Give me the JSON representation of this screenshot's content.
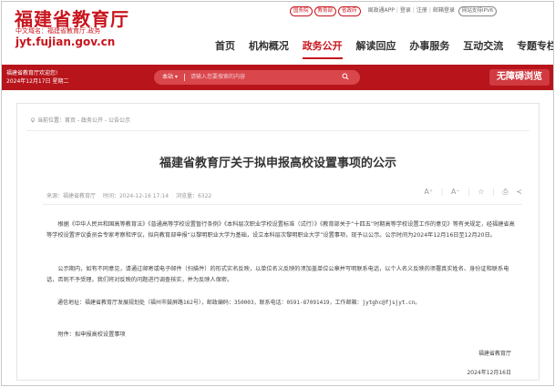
{
  "header": {
    "title": "福建省教育厅",
    "domain_cn": "中文域名：福建省教育厅.政务",
    "domain": "jyt.fujian.gov.cn",
    "badges": [
      "国务院",
      "教育部",
      "省政府"
    ],
    "links": [
      "闽政通APP",
      "登录",
      "注册",
      "邮箱登录"
    ],
    "ipv6": "网站支持IPV6"
  },
  "nav": {
    "items": [
      "首页",
      "机构概况",
      "政务公开",
      "解读回应",
      "办事服务",
      "互动交流",
      "专题专栏"
    ],
    "active_index": 2
  },
  "bar": {
    "welcome_line1": "福建省教育厅欢迎您!",
    "welcome_line2": "2024年12月17日 星期二",
    "search_scope": "本站",
    "search_placeholder": "请输入您要搜索的内容",
    "accessibility": "无障碍浏览"
  },
  "breadcrumb": {
    "label": "当前位置：",
    "path": "首页 - 政务公开 - 公告公示"
  },
  "article": {
    "title": "福建省教育厅关于拟申报高校设置事项的公示",
    "source": "来源：福建省教育厅",
    "time": "时间：2024-12-16 17:14",
    "views": "浏览量：6322",
    "tools": [
      "A⁺",
      "A⁻"
    ],
    "para1": "根据《中华人民共和国高等教育法》《普通高等学校设置暂行条例》《本科层次职业学校设置标准（试行）》《教育部关于“十四五”时期高等学校设置工作的意见》等有关规定，经福建省高等学校设置评议委员会专家考察和评议，拟向教育部申报“以黎明职业大学为基础，设立本科层次黎明职业大学”设置事项，现予以公示。公示时间为2024年12月16日至12月20日。",
    "para2": "公示期内，如有不同意见，请通过邮寄或电子邮件（扫描件）的形式实名反映，以单位名义反映的须加盖单位公章并写明联系电话，以个人名义反映的须署真实姓名、身份证和联系电话，否则不予受理。我们将对反映的问题进行调查核实，并为反映人保密。",
    "para3": "通信地址：福建省教育厅发展规划处（福州市鼓屏路162号），邮政编码：350003，联系电话：0591-87091419，工作邮箱：jytghc@fjsjyt.cn。",
    "para4": "附件：拟申报高校设置事项",
    "signature": "福建省教育厅",
    "date": "2024年12月16日"
  },
  "colors": {
    "brand_red": "#c8151d",
    "bar_red": "#b8141b"
  }
}
